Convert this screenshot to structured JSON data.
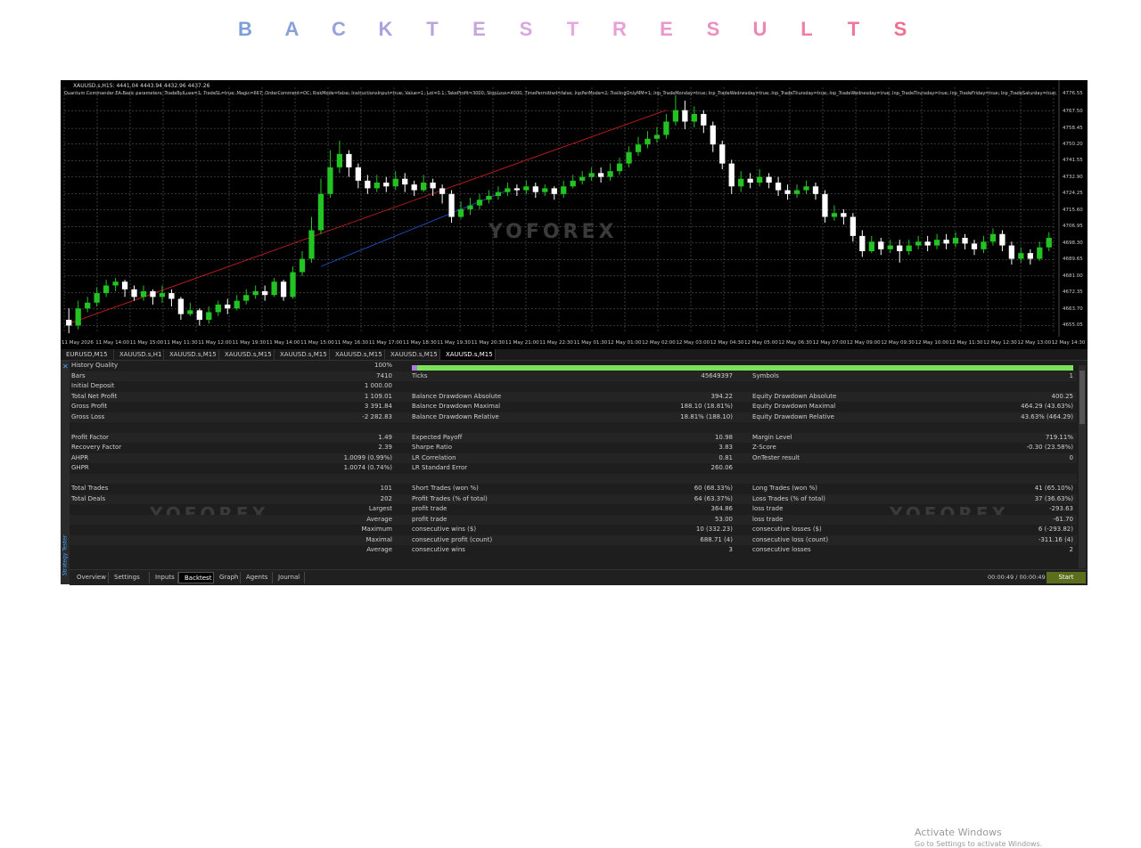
{
  "title_letters": [
    "B",
    "A",
    "C",
    "K",
    "T",
    "E",
    "S",
    "T",
    "R",
    "E",
    "S",
    "U",
    "L",
    "T",
    "S"
  ],
  "colors": {
    "title_start": "#7b9fd8",
    "title_mid": "#e7a8e2",
    "title_end": "#ef6f8f",
    "bull": "#22c322",
    "bear": "#ffffff",
    "grid": "#6e6e6e",
    "trend": "#c21d1d",
    "trend2": "#1e4fbf",
    "quality": "#7be35a",
    "start": "#5a6e1c"
  },
  "chart": {
    "header": "XAUUSD.s,H15: 4441.04 4443.94 4432.96 4437.26",
    "params": "Quantum Commander EA-Basic parameters: TradeBylLuse=1; TradeSL=true; Magic=667; OrderComment=OC; RiskMode=false; InstructionsInput=true; Value=1; Lot=0.1; TakeProfit=3000; StopLoss=4000; TimePermitted=false; InpPerMode=2; TrailingOnlyMM=1; Inp_TradeMonday=true; Inp_TradeWednesday=true; Inp_TradeThursday=true; Inp_TradeWednesday=true; Inp_TradeThursday=true; Inp_TradeFriday=true; Inp_TradeSaturday=true; Inp_Trade",
    "price_labels": [
      "4776.55",
      "4767.50",
      "4758.45",
      "4750.20",
      "4741.55",
      "4732.90",
      "4724.25",
      "4715.60",
      "4706.95",
      "4698.30",
      "4689.65",
      "4681.00",
      "4672.35",
      "4663.70",
      "4655.05"
    ],
    "time_labels": [
      "11 May 2026",
      "11 May 14:00",
      "11 May 15:00",
      "11 May 11:30",
      "11 May 12:00",
      "11 May 19:30",
      "11 May 14:00",
      "11 May 15:00",
      "11 May 16:30",
      "11 May 17:00",
      "11 May 18:30",
      "11 May 19:30",
      "11 May 20:30",
      "11 May 21:00",
      "11 May 22:30",
      "11 May 01:30",
      "12 May 01:00",
      "12 May 02:00",
      "12 May 03:00",
      "12 May 04:30",
      "12 May 05:00",
      "12 May 06:30",
      "12 May 07:00",
      "12 May 09:00",
      "12 May 09:30",
      "12 May 10:00",
      "12 May 11:30",
      "12 May 12:30",
      "12 May 13:00",
      "12 May 14:30"
    ],
    "watermark": "YOFOREX"
  },
  "chart_data": {
    "type": "candlestick",
    "ylim": [
      4651,
      4780
    ],
    "candles": [
      [
        4658,
        4655,
        4664,
        4651
      ],
      [
        4655,
        4664,
        4668,
        4653
      ],
      [
        4664,
        4667,
        4670,
        4662
      ],
      [
        4667,
        4672,
        4675,
        4665
      ],
      [
        4672,
        4676,
        4679,
        4670
      ],
      [
        4676,
        4678,
        4680,
        4673
      ],
      [
        4678,
        4674,
        4679,
        4670
      ],
      [
        4674,
        4670,
        4676,
        4668
      ],
      [
        4670,
        4673,
        4676,
        4668
      ],
      [
        4673,
        4670,
        4674,
        4666
      ],
      [
        4670,
        4672,
        4676,
        4667
      ],
      [
        4672,
        4669,
        4674,
        4665
      ],
      [
        4669,
        4661,
        4670,
        4658
      ],
      [
        4661,
        4663,
        4667,
        4660
      ],
      [
        4663,
        4658,
        4664,
        4655
      ],
      [
        4658,
        4662,
        4665,
        4656
      ],
      [
        4662,
        4666,
        4668,
        4660
      ],
      [
        4666,
        4664,
        4669,
        4661
      ],
      [
        4664,
        4668,
        4671,
        4663
      ],
      [
        4668,
        4671,
        4674,
        4666
      ],
      [
        4671,
        4673,
        4676,
        4669
      ],
      [
        4673,
        4671,
        4676,
        4668
      ],
      [
        4671,
        4678,
        4680,
        4670
      ],
      [
        4678,
        4670,
        4679,
        4668
      ],
      [
        4670,
        4683,
        4686,
        4669
      ],
      [
        4683,
        4690,
        4694,
        4681
      ],
      [
        4690,
        4705,
        4712,
        4688
      ],
      [
        4705,
        4724,
        4732,
        4703
      ],
      [
        4724,
        4738,
        4747,
        4722
      ],
      [
        4738,
        4745,
        4752,
        4735
      ],
      [
        4745,
        4738,
        4747,
        4733
      ],
      [
        4738,
        4731,
        4740,
        4727
      ],
      [
        4731,
        4727,
        4734,
        4724
      ],
      [
        4727,
        4730,
        4734,
        4725
      ],
      [
        4730,
        4728,
        4733,
        4725
      ],
      [
        4728,
        4732,
        4736,
        4726
      ],
      [
        4732,
        4729,
        4735,
        4725
      ],
      [
        4729,
        4726,
        4731,
        4723
      ],
      [
        4726,
        4730,
        4734,
        4725
      ],
      [
        4730,
        4727,
        4732,
        4723
      ],
      [
        4727,
        4724,
        4729,
        4719
      ],
      [
        4724,
        4712,
        4726,
        4709
      ],
      [
        4712,
        4716,
        4720,
        4711
      ],
      [
        4716,
        4718,
        4722,
        4713
      ],
      [
        4718,
        4721,
        4724,
        4716
      ],
      [
        4721,
        4723,
        4726,
        4719
      ],
      [
        4723,
        4725,
        4728,
        4721
      ],
      [
        4725,
        4727,
        4730,
        4723
      ],
      [
        4727,
        4726,
        4729,
        4723
      ],
      [
        4726,
        4728,
        4731,
        4724
      ],
      [
        4728,
        4725,
        4730,
        4722
      ],
      [
        4725,
        4727,
        4729,
        4723
      ],
      [
        4727,
        4724,
        4728,
        4721
      ],
      [
        4724,
        4728,
        4731,
        4722
      ],
      [
        4728,
        4731,
        4734,
        4727
      ],
      [
        4731,
        4733,
        4736,
        4729
      ],
      [
        4733,
        4735,
        4738,
        4731
      ],
      [
        4735,
        4733,
        4738,
        4730
      ],
      [
        4733,
        4736,
        4740,
        4731
      ],
      [
        4736,
        4740,
        4743,
        4734
      ],
      [
        4740,
        4746,
        4749,
        4738
      ],
      [
        4746,
        4750,
        4754,
        4744
      ],
      [
        4750,
        4753,
        4757,
        4748
      ],
      [
        4753,
        4755,
        4759,
        4751
      ],
      [
        4755,
        4762,
        4766,
        4753
      ],
      [
        4762,
        4768,
        4776,
        4760
      ],
      [
        4768,
        4762,
        4773,
        4758
      ],
      [
        4762,
        4766,
        4770,
        4759
      ],
      [
        4766,
        4760,
        4768,
        4756
      ],
      [
        4760,
        4750,
        4762,
        4746
      ],
      [
        4750,
        4740,
        4752,
        4737
      ],
      [
        4740,
        4728,
        4742,
        4724
      ],
      [
        4728,
        4732,
        4736,
        4725
      ],
      [
        4732,
        4730,
        4735,
        4727
      ],
      [
        4730,
        4733,
        4737,
        4728
      ],
      [
        4733,
        4730,
        4735,
        4727
      ],
      [
        4730,
        4726,
        4733,
        4723
      ],
      [
        4726,
        4724,
        4729,
        4721
      ],
      [
        4724,
        4726,
        4729,
        4722
      ],
      [
        4726,
        4728,
        4731,
        4724
      ],
      [
        4728,
        4724,
        4730,
        4721
      ],
      [
        4724,
        4712,
        4726,
        4709
      ],
      [
        4712,
        4714,
        4718,
        4710
      ],
      [
        4714,
        4712,
        4716,
        4708
      ],
      [
        4712,
        4702,
        4714,
        4699
      ],
      [
        4702,
        4694,
        4705,
        4691
      ],
      [
        4694,
        4699,
        4702,
        4693
      ],
      [
        4699,
        4695,
        4701,
        4692
      ],
      [
        4695,
        4697,
        4700,
        4693
      ],
      [
        4697,
        4694,
        4700,
        4688
      ],
      [
        4694,
        4697,
        4700,
        4692
      ],
      [
        4697,
        4699,
        4702,
        4695
      ],
      [
        4699,
        4697,
        4702,
        4694
      ],
      [
        4697,
        4700,
        4703,
        4695
      ],
      [
        4700,
        4698,
        4703,
        4695
      ],
      [
        4698,
        4701,
        4704,
        4696
      ],
      [
        4701,
        4698,
        4703,
        4695
      ],
      [
        4698,
        4695,
        4700,
        4692
      ],
      [
        4695,
        4699,
        4702,
        4693
      ],
      [
        4699,
        4703,
        4706,
        4697
      ],
      [
        4703,
        4697,
        4705,
        4694
      ],
      [
        4697,
        4690,
        4699,
        4687
      ],
      [
        4690,
        4693,
        4696,
        4688
      ],
      [
        4693,
        4690,
        4695,
        4687
      ],
      [
        4690,
        4696,
        4699,
        4689
      ],
      [
        4696,
        4701,
        4704,
        4694
      ]
    ],
    "trendlines": [
      {
        "from": [
          0,
          4656
        ],
        "to": [
          64,
          4768
        ],
        "color": "trend"
      },
      {
        "from": [
          27,
          4686
        ],
        "to": [
          47,
          4726
        ],
        "color": "trend2"
      }
    ]
  },
  "symbol_tabs": [
    "EURUSD,M15",
    "XAUUSD.s,H1",
    "XAUUSD.s,M15",
    "XAUUSD.s,M15",
    "XAUUSD.s,M15",
    "XAUUSD.s,M15",
    "XAUUSD.s,M15",
    "XAUUSD.s,M15"
  ],
  "side_label": "Strategy Tester",
  "results": [
    {
      "l1": "History Quality",
      "v1": "100%"
    },
    {
      "l1": "Bars",
      "v1": "7410",
      "l2": "Ticks",
      "v2": "45649397",
      "l3": "Symbols",
      "v3": "1"
    },
    {
      "l1": "Initial Deposit",
      "v1": "1 000.00"
    },
    {
      "l1": "Total Net Profit",
      "v1": "1 109.01",
      "l2": "Balance Drawdown Absolute",
      "v2": "394.22",
      "l3": "Equity Drawdown Absolute",
      "v3": "400.25"
    },
    {
      "l1": "Gross Profit",
      "v1": "3 391.84",
      "l2": "Balance Drawdown Maximal",
      "v2": "188.10 (18.81%)",
      "l3": "Equity Drawdown Maximal",
      "v3": "464.29 (43.63%)"
    },
    {
      "l1": "Gross Loss",
      "v1": "-2 282.83",
      "l2": "Balance Drawdown Relative",
      "v2": "18.81% (188.10)",
      "l3": "Equity Drawdown Relative",
      "v3": "43.63% (464.29)"
    },
    {},
    {
      "l1": "Profit Factor",
      "v1": "1.49",
      "l2": "Expected Payoff",
      "v2": "10.98",
      "l3": "Margin Level",
      "v3": "719.11%"
    },
    {
      "l1": "Recovery Factor",
      "v1": "2.39",
      "l2": "Sharpe Ratio",
      "v2": "3.83",
      "l3": "Z-Score",
      "v3": "-0.30 (23.58%)"
    },
    {
      "l1": "AHPR",
      "v1": "1.0099 (0.99%)",
      "l2": "LR Correlation",
      "v2": "0.81",
      "l3": "OnTester result",
      "v3": "0"
    },
    {
      "l1": "GHPR",
      "v1": "1.0074 (0.74%)",
      "l2": "LR Standard Error",
      "v2": "260.06"
    },
    {},
    {
      "l1": "Total Trades",
      "v1": "101",
      "l2": "Short Trades (won %)",
      "v2": "60 (68.33%)",
      "l3": "Long Trades (won %)",
      "v3": "41 (65.10%)"
    },
    {
      "l1": "Total Deals",
      "v1": "202",
      "l2": "Profit Trades (% of total)",
      "v2": "64 (63.37%)",
      "l3": "Loss Trades (% of total)",
      "v3": "37 (36.63%)"
    },
    {
      "r1": "Largest",
      "l2": "profit trade",
      "v2": "364.86",
      "l3": "loss trade",
      "v3": "-293.63"
    },
    {
      "r1": "Average",
      "l2": "profit trade",
      "v2": "53.00",
      "l3": "loss trade",
      "v3": "-61.70"
    },
    {
      "r1": "Maximum",
      "l2": "consecutive wins ($)",
      "v2": "10 (332.23)",
      "l3": "consecutive losses ($)",
      "v3": "6 (-293.82)"
    },
    {
      "r1": "Maximal",
      "l2": "consecutive profit (count)",
      "v2": "688.71 (4)",
      "l3": "consecutive loss (count)",
      "v3": "-311.16 (4)"
    },
    {
      "r1": "Average",
      "l2": "consecutive wins",
      "v2": "3",
      "l3": "consecutive losses",
      "v3": "2"
    }
  ],
  "bottom_tabs": [
    "Overview",
    "Settings",
    "Inputs",
    "Backtest",
    "Graph",
    "Agents",
    "Journal"
  ],
  "active_bottom_tab": "Backtest",
  "timer": "00:00:49 / 00:00:49",
  "start_label": "Start",
  "activate": {
    "line1": "Activate Windows",
    "line2": "Go to Settings to activate Windows."
  },
  "tester_watermark": "YOFOREX"
}
